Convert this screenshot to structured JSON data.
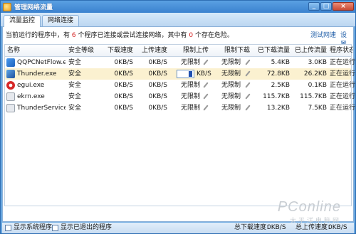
{
  "window": {
    "title": "管理网络流量",
    "controls": [
      "_",
      "□",
      "×"
    ]
  },
  "tabs": [
    {
      "label": "流量监控",
      "active": true
    },
    {
      "label": "网络连接",
      "active": false
    }
  ],
  "info": {
    "prefix": "当前运行的程序中，有",
    "count_connecting": "6",
    "middle": "个程序已连接或尝试连接网络，其中有",
    "count_danger": "0",
    "suffix": "个存在危险。",
    "speed_test_link": "测试网速",
    "settings_link": "设置"
  },
  "table": {
    "columns": [
      "名称",
      "安全等级",
      "下载速度",
      "上传速度",
      "限制上传",
      "限制下载",
      "已下载流量",
      "已上传流量",
      "程序状态"
    ],
    "rows": [
      {
        "name": "QQPCNetFlow.exe",
        "icon": "qqpcnetflow-icon",
        "security": "安全",
        "down": "0KB/S",
        "up": "0KB/S",
        "limit_up": "无限制",
        "limit_down": "无限制",
        "downloaded": "5.4KB",
        "uploaded": "3.0KB",
        "status": "正在运行"
      },
      {
        "name": "Thunder.exe",
        "icon": "thunder-icon",
        "security": "安全",
        "down": "0KB/S",
        "up": "0KB/S",
        "limit_up": "KB/S",
        "limit_up_input": "",
        "limit_down": "无限制",
        "downloaded": "72.8KB",
        "uploaded": "26.2KB",
        "status": "正在运行",
        "selected": true
      },
      {
        "name": "egui.exe",
        "icon": "egui-icon",
        "security": "安全",
        "down": "0KB/S",
        "up": "0KB/S",
        "limit_up": "无限制",
        "limit_down": "无限制",
        "downloaded": "2.5KB",
        "uploaded": "0.1KB",
        "status": "正在运行"
      },
      {
        "name": "ekrn.exe",
        "icon": "ekrn-icon",
        "security": "安全",
        "down": "0KB/S",
        "up": "0KB/S",
        "limit_up": "无限制",
        "limit_down": "无限制",
        "downloaded": "115.7KB",
        "uploaded": "115.7KB",
        "status": "正在运行"
      },
      {
        "name": "ThunderService.exe",
        "name_display": "ThunderService...",
        "icon": "thunderservice-icon",
        "security": "安全",
        "down": "0KB/S",
        "up": "0KB/S",
        "limit_up": "无限制",
        "limit_down": "无限制",
        "downloaded": "13.2KB",
        "uploaded": "7.5KB",
        "status": "正在运行"
      }
    ]
  },
  "watermark": {
    "main": "PConline",
    "sub": "太平洋电脑网"
  },
  "footer": {
    "show_system": "显示系统程序",
    "show_exited": "显示已退出的程序",
    "total_down_label": "总下载速度：",
    "total_down": "0KB/S",
    "total_up_label": "总上传速度：",
    "total_up": "0KB/S"
  },
  "colors": {
    "accent": "#3b82cf",
    "danger": "#d41f1f",
    "selected_row": "#fbf1d0",
    "link": "#1f5ea8"
  }
}
